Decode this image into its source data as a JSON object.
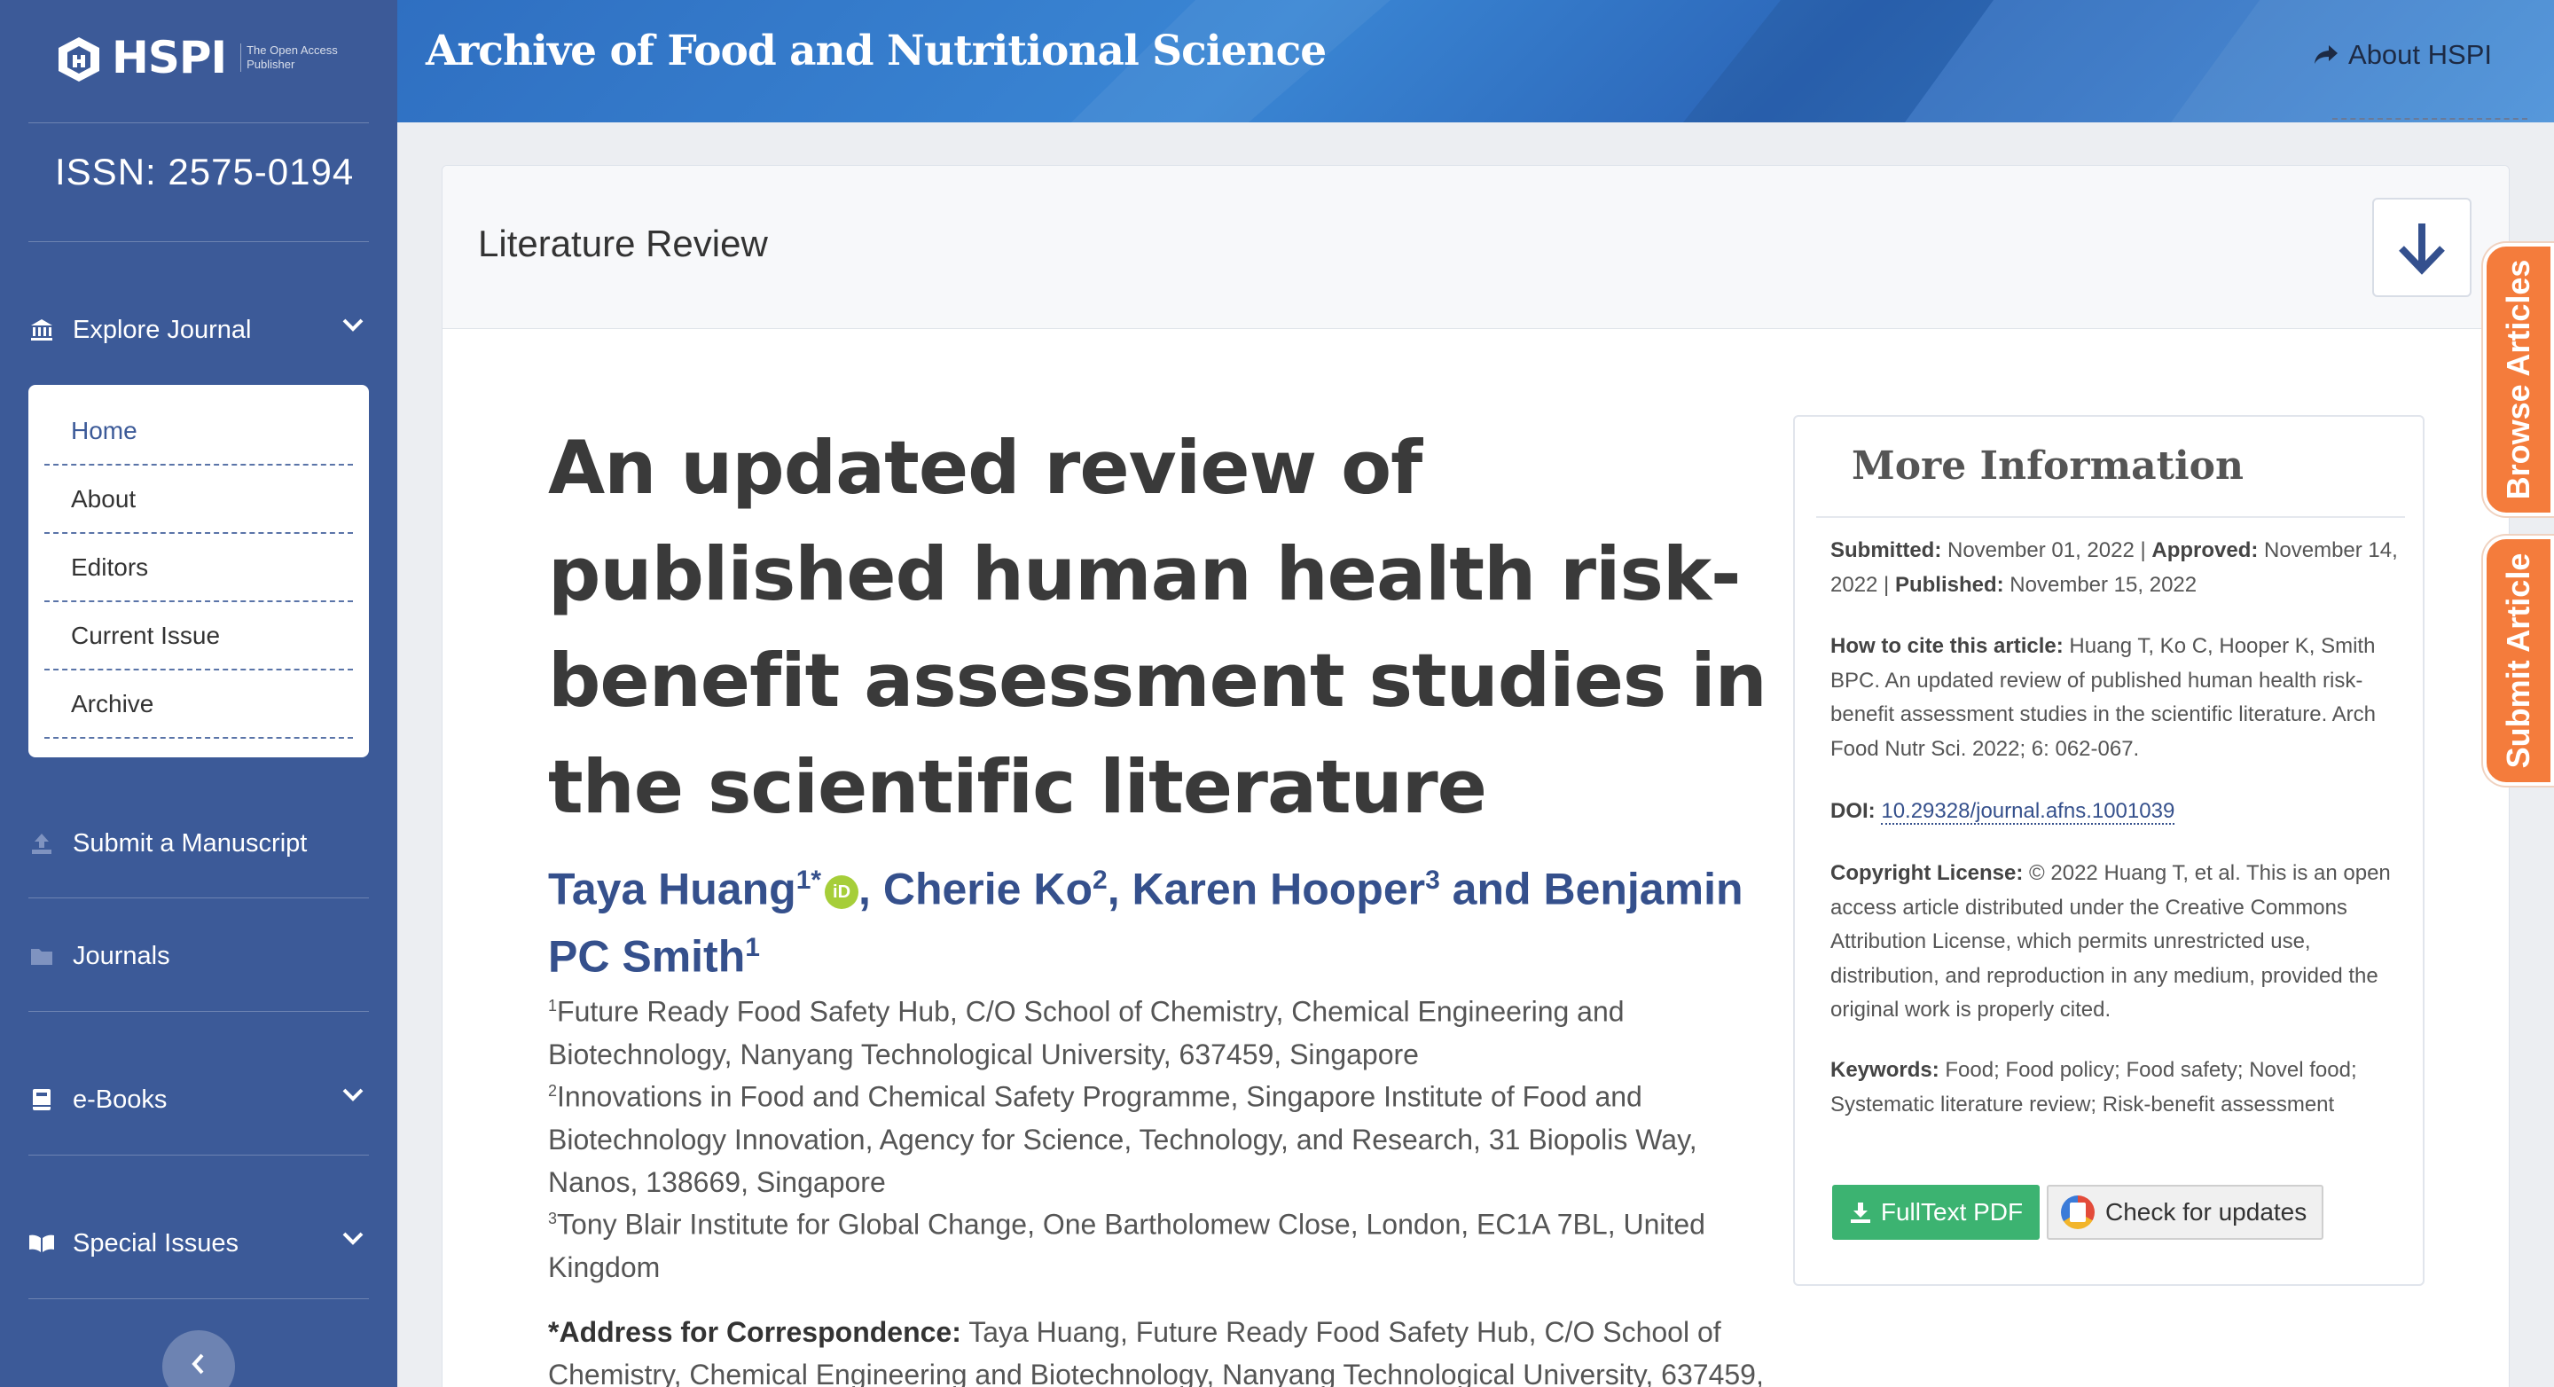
{
  "brand": {
    "logo_text": "HSPI",
    "logo_sub": "The Open Access Publisher",
    "issn": "ISSN: 2575-0194"
  },
  "sidebar": {
    "explore": "Explore Journal",
    "submenu": [
      "Home",
      "About",
      "Editors",
      "Current Issue",
      "Archive"
    ],
    "submit": "Submit a Manuscript",
    "journals": "Journals",
    "ebooks": "e-Books",
    "special": "Special Issues"
  },
  "header": {
    "journal_title": "Archive of Food and Nutritional Science",
    "about_link": "About HSPI"
  },
  "card": {
    "type": "Literature Review"
  },
  "article": {
    "title": "An updated review of published human health risk-benefit assessment studies in the scientific literature",
    "authors": {
      "a1": "Taya Huang",
      "a1_sup": "1*",
      "a2": ", Cherie Ko",
      "a2_sup": "2",
      "a3": ", Karen Hooper",
      "a3_sup": "3",
      "a4": " and Benjamin PC Smith",
      "a4_sup": "1"
    },
    "affiliations": [
      {
        "sup": "1",
        "text": "Future Ready Food Safety Hub, C/O School of Chemistry, Chemical Engineering and Biotechnology, Nanyang Technological University, 637459, Singapore"
      },
      {
        "sup": "2",
        "text": "Innovations in Food and Chemical Safety Programme, Singapore Institute of Food and Biotechnology Innovation, Agency for Science, Technology, and Research, 31 Biopolis Way, Nanos, 138669, Singapore"
      },
      {
        "sup": "3",
        "text": "Tony Blair Institute for Global Change, One Bartholomew Close, London, EC1A 7BL, United Kingdom"
      }
    ],
    "corr_label": "*Address for Correspondence:",
    "corr_text": " Taya Huang, Future Ready Food Safety Hub, C/O School of Chemistry, Chemical Engineering and Biotechnology, Nanyang Technological University, 637459,"
  },
  "info": {
    "title": "More Information",
    "submitted_label": "Submitted:",
    "submitted": " November 01, 2022 | ",
    "approved_label": "Approved:",
    "approved": " November 14, 2022 | ",
    "published_label": "Published:",
    "published": " November 15, 2022",
    "cite_label": "How to cite this article:",
    "cite": " Huang T, Ko C, Hooper K, Smith BPC. An updated review of published human health risk-benefit assessment studies in the scientific literature. Arch Food Nutr Sci. 2022; 6: 062-067.",
    "doi_label": "DOI:",
    "doi": "10.29328/journal.afns.1001039",
    "license_label": "Copyright License:",
    "license": " © 2022 Huang T, et al. This is an open access article distributed under the Creative Commons Attribution License, which permits unrestricted use, distribution, and reproduction in any medium, provided the original work is properly cited.",
    "keywords_label": "Keywords:",
    "keywords": " Food; Food policy; Food safety; Novel food; Systematic literature review; Risk-benefit assessment",
    "btn_pdf": "FullText PDF",
    "btn_updates": "Check for updates"
  },
  "side_tabs": {
    "browse": "Browse Articles",
    "submit": "Submit Article"
  }
}
